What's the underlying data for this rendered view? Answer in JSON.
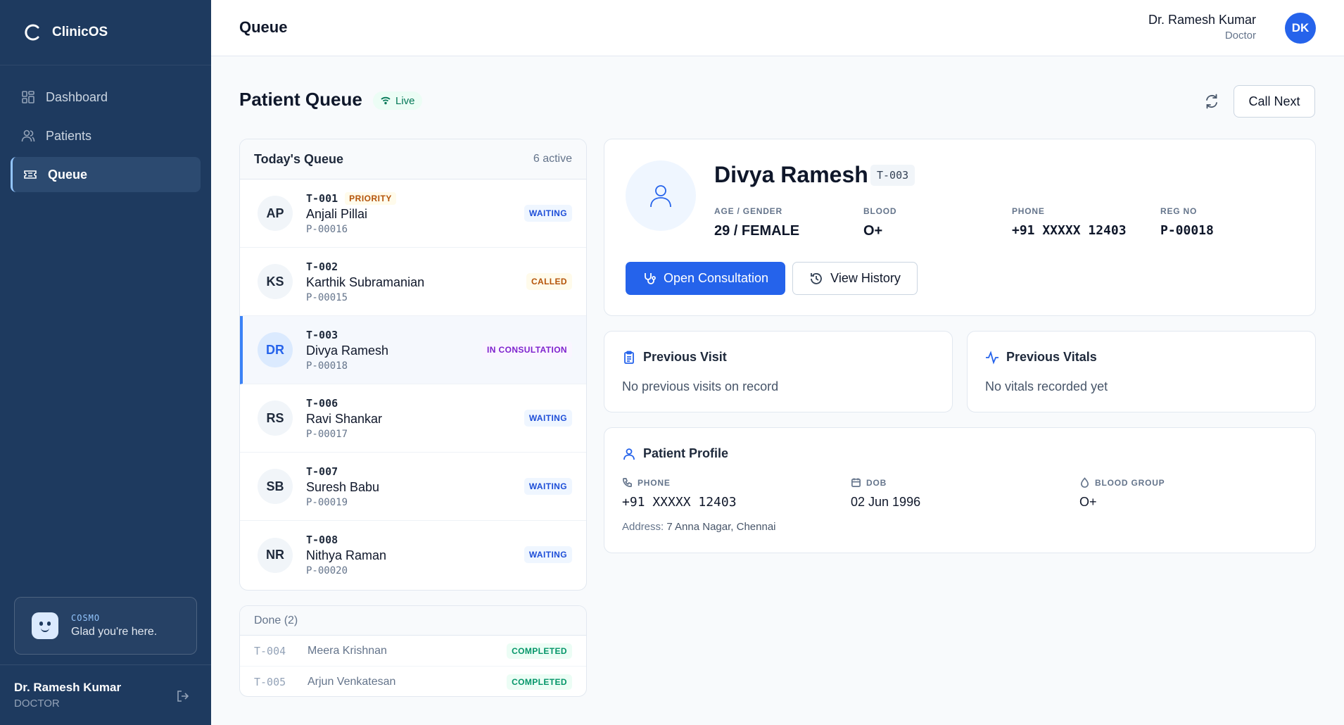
{
  "brand": {
    "name": "ClinicOS"
  },
  "sidebar": {
    "items": [
      {
        "label": "Dashboard",
        "icon": "grid-icon",
        "active": false
      },
      {
        "label": "Patients",
        "icon": "users-icon",
        "active": false
      },
      {
        "label": "Queue",
        "icon": "ticket-icon",
        "active": true
      }
    ],
    "cosmo": {
      "label": "COSMO",
      "message": "Glad you're here."
    },
    "user": {
      "name": "Dr. Ramesh Kumar",
      "role": "DOCTOR"
    }
  },
  "header": {
    "title": "Queue",
    "user_name": "Dr. Ramesh Kumar",
    "user_role": "Doctor",
    "avatar_initials": "DK"
  },
  "page": {
    "title": "Patient Queue",
    "live_label": "Live",
    "call_next_label": "Call Next"
  },
  "queue": {
    "title": "Today's Queue",
    "count_label": "6 active",
    "rows": [
      {
        "initials": "AP",
        "token": "T-001",
        "priority": "PRIORITY",
        "name": "Anjali Pillai",
        "pid": "P-00016",
        "status": "WAITING"
      },
      {
        "initials": "KS",
        "token": "T-002",
        "priority": "",
        "name": "Karthik Subramanian",
        "pid": "P-00015",
        "status": "CALLED"
      },
      {
        "initials": "DR",
        "token": "T-003",
        "priority": "",
        "name": "Divya Ramesh",
        "pid": "P-00018",
        "status": "IN CONSULTATION"
      },
      {
        "initials": "RS",
        "token": "T-006",
        "priority": "",
        "name": "Ravi Shankar",
        "pid": "P-00017",
        "status": "WAITING"
      },
      {
        "initials": "SB",
        "token": "T-007",
        "priority": "",
        "name": "Suresh Babu",
        "pid": "P-00019",
        "status": "WAITING"
      },
      {
        "initials": "NR",
        "token": "T-008",
        "priority": "",
        "name": "Nithya Raman",
        "pid": "P-00020",
        "status": "WAITING"
      }
    ]
  },
  "done": {
    "title": "Done (2)",
    "rows": [
      {
        "token": "T-004",
        "name": "Meera Krishnan",
        "status": "COMPLETED"
      },
      {
        "token": "T-005",
        "name": "Arjun Venkatesan",
        "status": "COMPLETED"
      }
    ]
  },
  "patient": {
    "name": "Divya Ramesh",
    "token": "T-003",
    "age_gender_label": "AGE / GENDER",
    "age_gender": "29 / FEMALE",
    "blood_label": "BLOOD",
    "blood": "O+",
    "phone_label": "PHONE",
    "phone": "+91 XXXXX 12403",
    "reg_label": "REG NO",
    "reg": "P-00018",
    "open_consultation_label": "Open Consultation",
    "view_history_label": "View History"
  },
  "previous_visit": {
    "title": "Previous Visit",
    "body": "No previous visits on record"
  },
  "previous_vitals": {
    "title": "Previous Vitals",
    "body": "No vitals recorded yet"
  },
  "profile": {
    "title": "Patient Profile",
    "phone_label": "PHONE",
    "phone": "+91 XXXXX 12403",
    "dob_label": "DOB",
    "dob": "02 Jun 1996",
    "blood_group_label": "BLOOD GROUP",
    "blood_group": "O+",
    "address_label": "Address:",
    "address": "7 Anna Nagar, Chennai"
  },
  "colors": {
    "sidebar": "#1e3a5f",
    "accent": "#2563eb",
    "waiting": "#1d4ed8",
    "called": "#b45309",
    "in_consultation": "#7e22ce",
    "completed": "#059669"
  }
}
